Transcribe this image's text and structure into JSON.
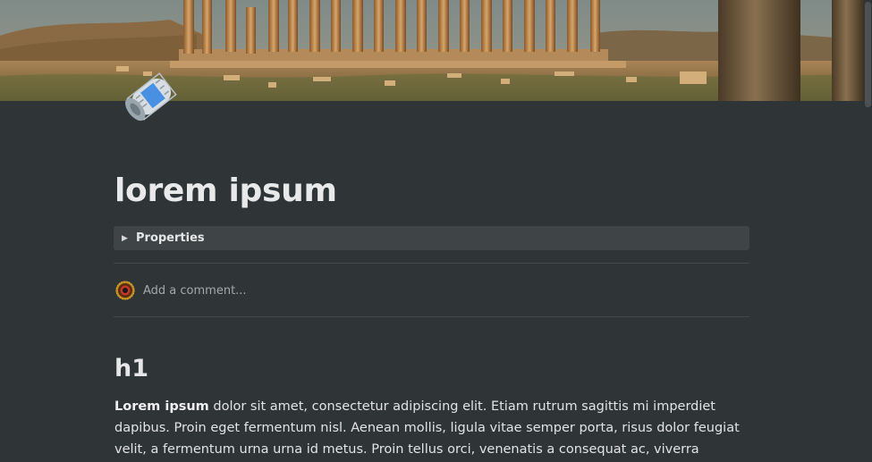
{
  "page": {
    "title": "lorem ipsum",
    "icon": "newspaper-icon"
  },
  "properties": {
    "caret": "▶",
    "label": "Properties"
  },
  "comment": {
    "placeholder": "Add a comment..."
  },
  "content": {
    "heading": "h1",
    "paragraph_bold": "Lorem ipsum",
    "paragraph_rest": " dolor sit amet, consectetur adipiscing elit. Etiam rutrum sagittis mi imperdiet dapibus. Proin eget fermentum nisl. Aenean mollis, ligula vitae semper porta, risus dolor feugiat velit, a fermentum urna urna id metus. Proin tellus orci, venenatis a consequat ac, viverra ultricies ligula."
  },
  "colors": {
    "background": "#2f3437",
    "properties_bg": "#3f4447",
    "text": "#e6e6e6",
    "muted_text": "#a5a8aa"
  }
}
